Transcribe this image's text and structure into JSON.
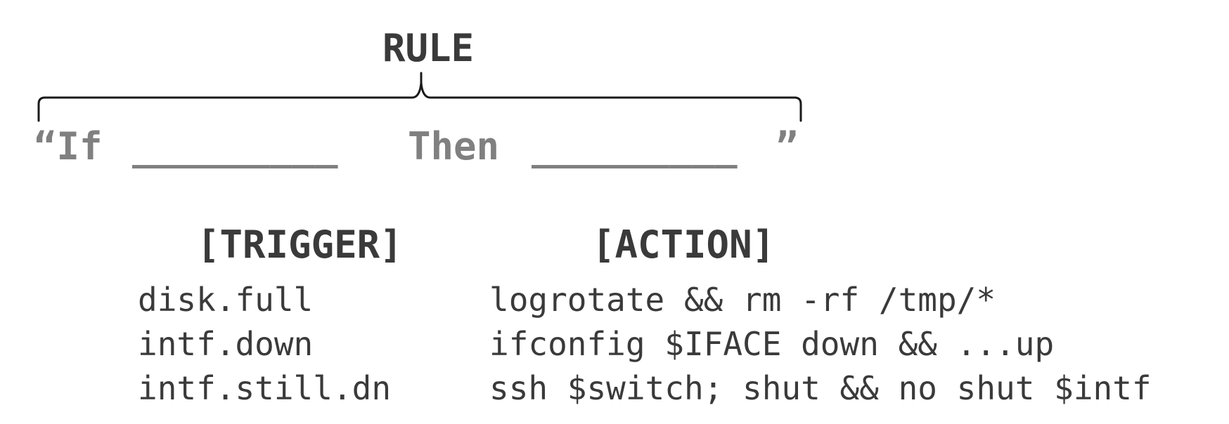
{
  "rule": {
    "title": "RULE",
    "open_quote_if": "“If",
    "blank_1": "_________",
    "then": "Then",
    "blank_2": "_________",
    "close_quote": "”"
  },
  "columns": {
    "trigger_header": "[TRIGGER]",
    "action_header": "[ACTION]"
  },
  "rows": [
    {
      "trigger": "disk.full",
      "action": "logrotate && rm -rf /tmp/*"
    },
    {
      "trigger": "intf.down",
      "action": "ifconfig $IFACE down && ...up"
    },
    {
      "trigger": "intf.still.dn",
      "action": "ssh $switch; shut && no shut $intf"
    }
  ],
  "colors": {
    "dark_text": "#3a3a3a",
    "template_gray": "#808080",
    "brace": "#1a1a1a"
  }
}
